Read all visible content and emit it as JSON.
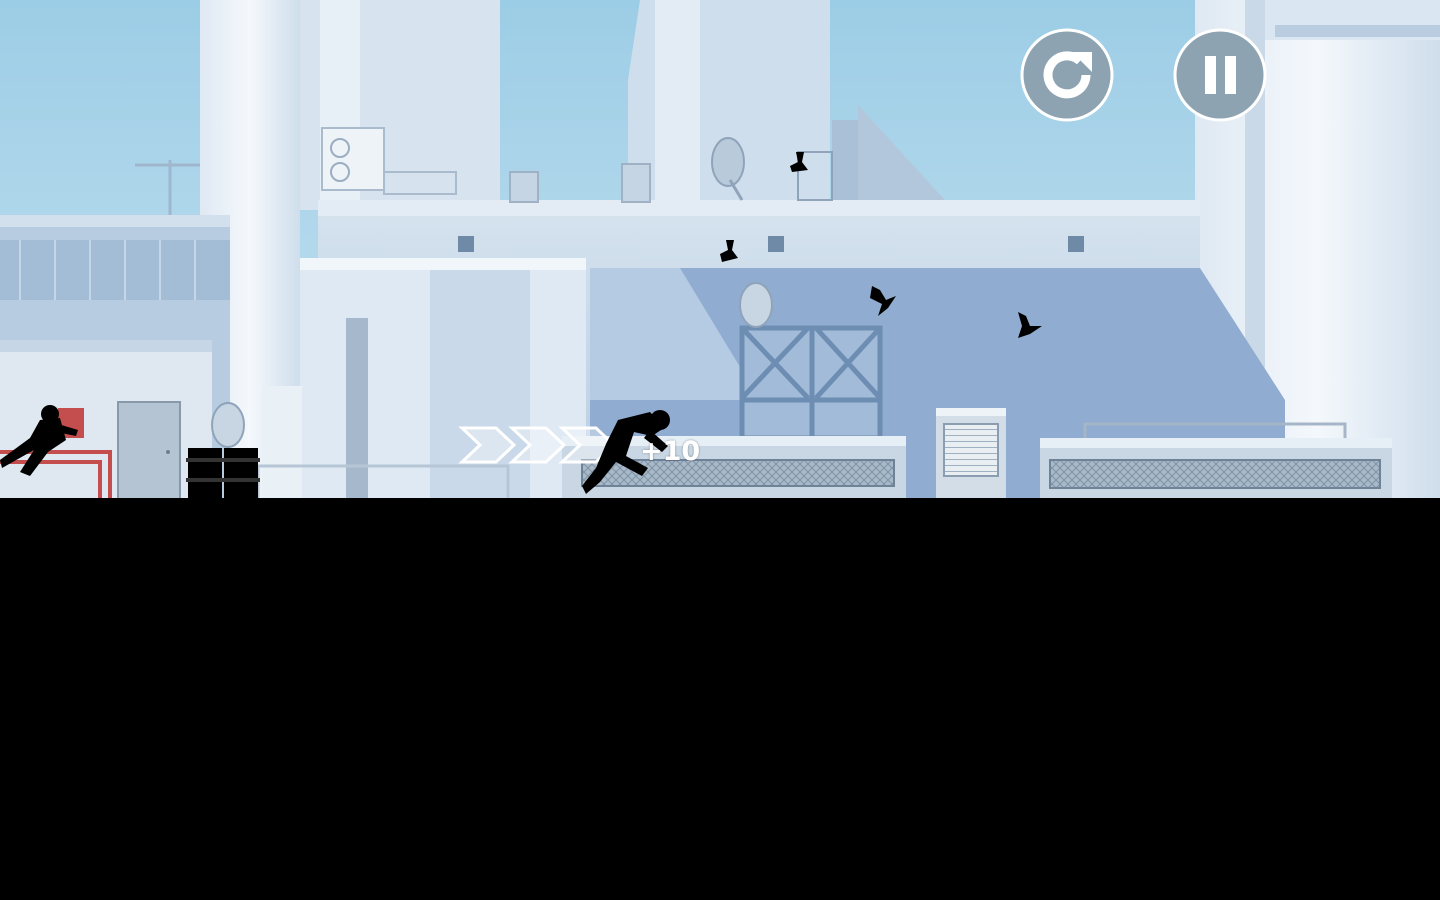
{
  "hud": {
    "restart_button": {
      "icon": "restart-icon"
    },
    "pause_button": {
      "icon": "pause-icon"
    },
    "score_popup": "+10"
  },
  "colors": {
    "sky": "#a9d3e9",
    "building_light": "#e6eef6",
    "building_mid": "#c2d5e8",
    "building_shadow": "#7f9fc4",
    "hud_button_fill": "#8ea3b1",
    "hud_button_border": "#ffffff",
    "silhouette": "#000000"
  },
  "scene": {
    "player": "runner-silhouette",
    "chaser": "hunter-silhouette",
    "speed_chevrons": 3,
    "birds": 5
  }
}
